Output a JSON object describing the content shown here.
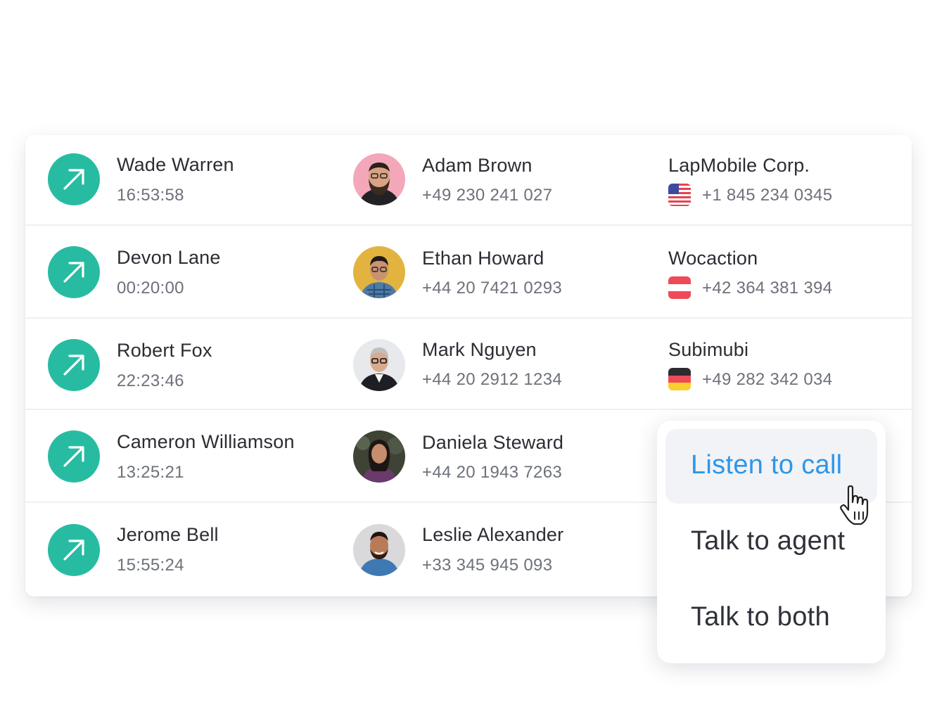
{
  "calls": [
    {
      "caller": "Wade Warren",
      "duration": "16:53:58",
      "contact": "Adam Brown",
      "contact_phone": "+49 230 241 027",
      "company": "LapMobile Corp.",
      "company_phone": "+1 845 234 0345",
      "flag": "us-flag-icon"
    },
    {
      "caller": "Devon Lane",
      "duration": "00:20:00",
      "contact": "Ethan Howard",
      "contact_phone": "+44 20 7421 0293",
      "company": "Wocaction",
      "company_phone": "+42 364 381 394",
      "flag": "austria-flag-icon"
    },
    {
      "caller": "Robert Fox",
      "duration": "22:23:46",
      "contact": "Mark Nguyen",
      "contact_phone": "+44 20 2912 1234",
      "company": "Subimubi",
      "company_phone": "+49 282 342 034",
      "flag": "germany-flag-icon"
    },
    {
      "caller": "Cameron Williamson",
      "duration": "13:25:21",
      "contact": "Daniela Steward",
      "contact_phone": "+44 20 1943 7263"
    },
    {
      "caller": "Jerome Bell",
      "duration": "15:55:24",
      "contact": "Leslie Alexander",
      "contact_phone": "+33 345 945 093"
    }
  ],
  "menu": {
    "items": [
      {
        "label": "Listen to call",
        "active": true
      },
      {
        "label": "Talk to agent",
        "active": false
      },
      {
        "label": "Talk to both",
        "active": false
      }
    ]
  },
  "colors": {
    "accent": "#27bca2",
    "menu_active_text": "#2e96e8",
    "menu_active_bg": "#f1f3f7"
  }
}
